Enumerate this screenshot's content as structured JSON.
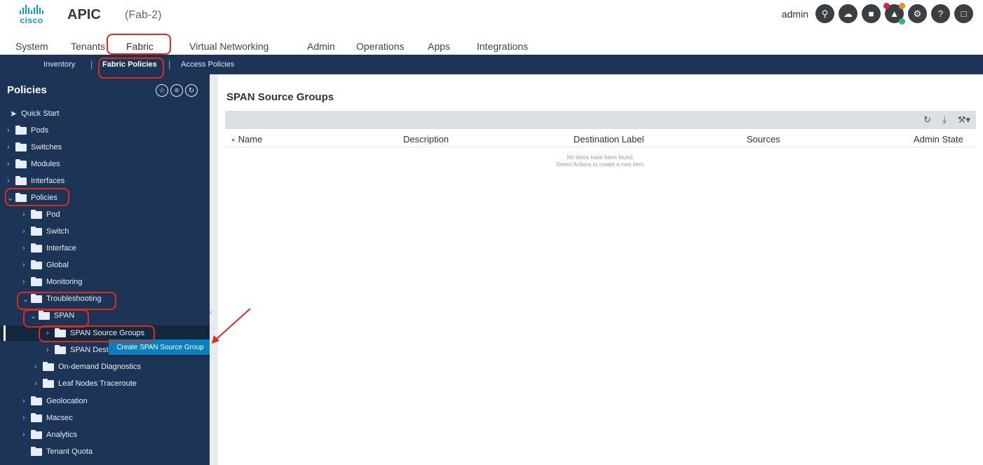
{
  "header": {
    "logo_text": "cisco",
    "app_title": "APIC",
    "app_subtitle": "(Fab-2)",
    "user": "admin",
    "icons": [
      "search-icon",
      "cloud-icon",
      "video-icon",
      "alerts-icon",
      "gear-icon",
      "help-icon",
      "chat-icon"
    ]
  },
  "main_nav": {
    "tabs": [
      "System",
      "Tenants",
      "Fabric",
      "Virtual Networking",
      "Admin",
      "Operations",
      "Apps",
      "Integrations"
    ],
    "active": "Fabric"
  },
  "sub_nav": {
    "items": [
      "Inventory",
      "Fabric Policies",
      "Access Policies"
    ],
    "active": "Fabric Policies",
    "separator": "|"
  },
  "sidebar": {
    "title": "Policies",
    "tree": [
      {
        "label": "Quick Start"
      },
      {
        "label": "Pods"
      },
      {
        "label": "Switches"
      },
      {
        "label": "Modules"
      },
      {
        "label": "Interfaces"
      },
      {
        "label": "Policies"
      },
      {
        "label": "Pod"
      },
      {
        "label": "Switch"
      },
      {
        "label": "Interface"
      },
      {
        "label": "Global"
      },
      {
        "label": "Monitoring"
      },
      {
        "label": "Troubleshooting"
      },
      {
        "label": "SPAN"
      },
      {
        "label": "SPAN Source Groups"
      },
      {
        "label": "SPAN Dest"
      },
      {
        "label": "On-demand Diagnostics"
      },
      {
        "label": "Leaf Nodes Traceroute"
      },
      {
        "label": "Geolocation"
      },
      {
        "label": "Macsec"
      },
      {
        "label": "Analytics"
      },
      {
        "label": "Tenant Quota"
      }
    ],
    "context_menu": "Create SPAN Source Group"
  },
  "content": {
    "title": "SPAN Source Groups",
    "columns": [
      "Name",
      "Description",
      "Destination Label",
      "Sources",
      "Admin State"
    ],
    "sort_indicator": "▲",
    "empty_line1": "No items have been found.",
    "empty_line2": "Select Actions to create a new item."
  },
  "colors": {
    "nav_bg": "#1c3557",
    "annotation": "#e02a1c",
    "context_menu_bg": "#0a7fbf",
    "cisco_blue": "#049fd9"
  }
}
